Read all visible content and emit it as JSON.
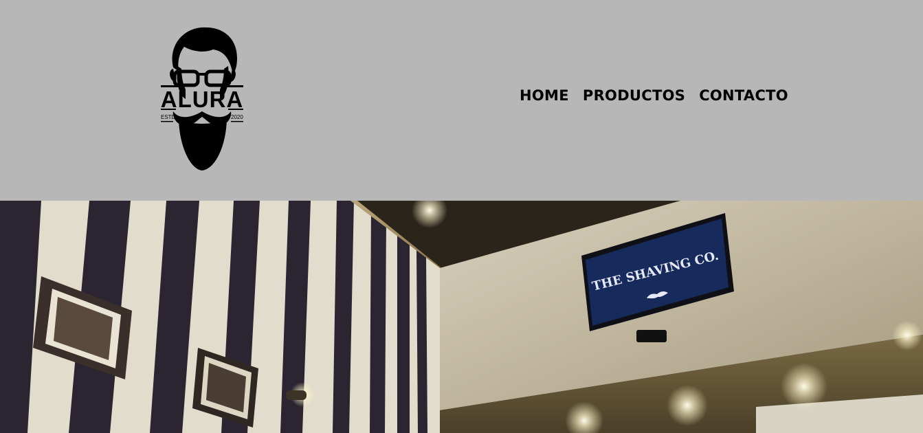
{
  "header": {
    "logo": {
      "name": "ALURA",
      "left_tag": "ESTD",
      "right_tag": "2020",
      "icon": "bearded-man-with-glasses-icon"
    },
    "nav": [
      {
        "label": "HOME"
      },
      {
        "label": "PRODUCTOS"
      },
      {
        "label": "CONTACTO"
      }
    ]
  },
  "banner": {
    "image": "barbershop-interior-photo",
    "tv_screen": {
      "title": "THE SHAVING CO.",
      "icon": "mustache-icon"
    }
  }
}
